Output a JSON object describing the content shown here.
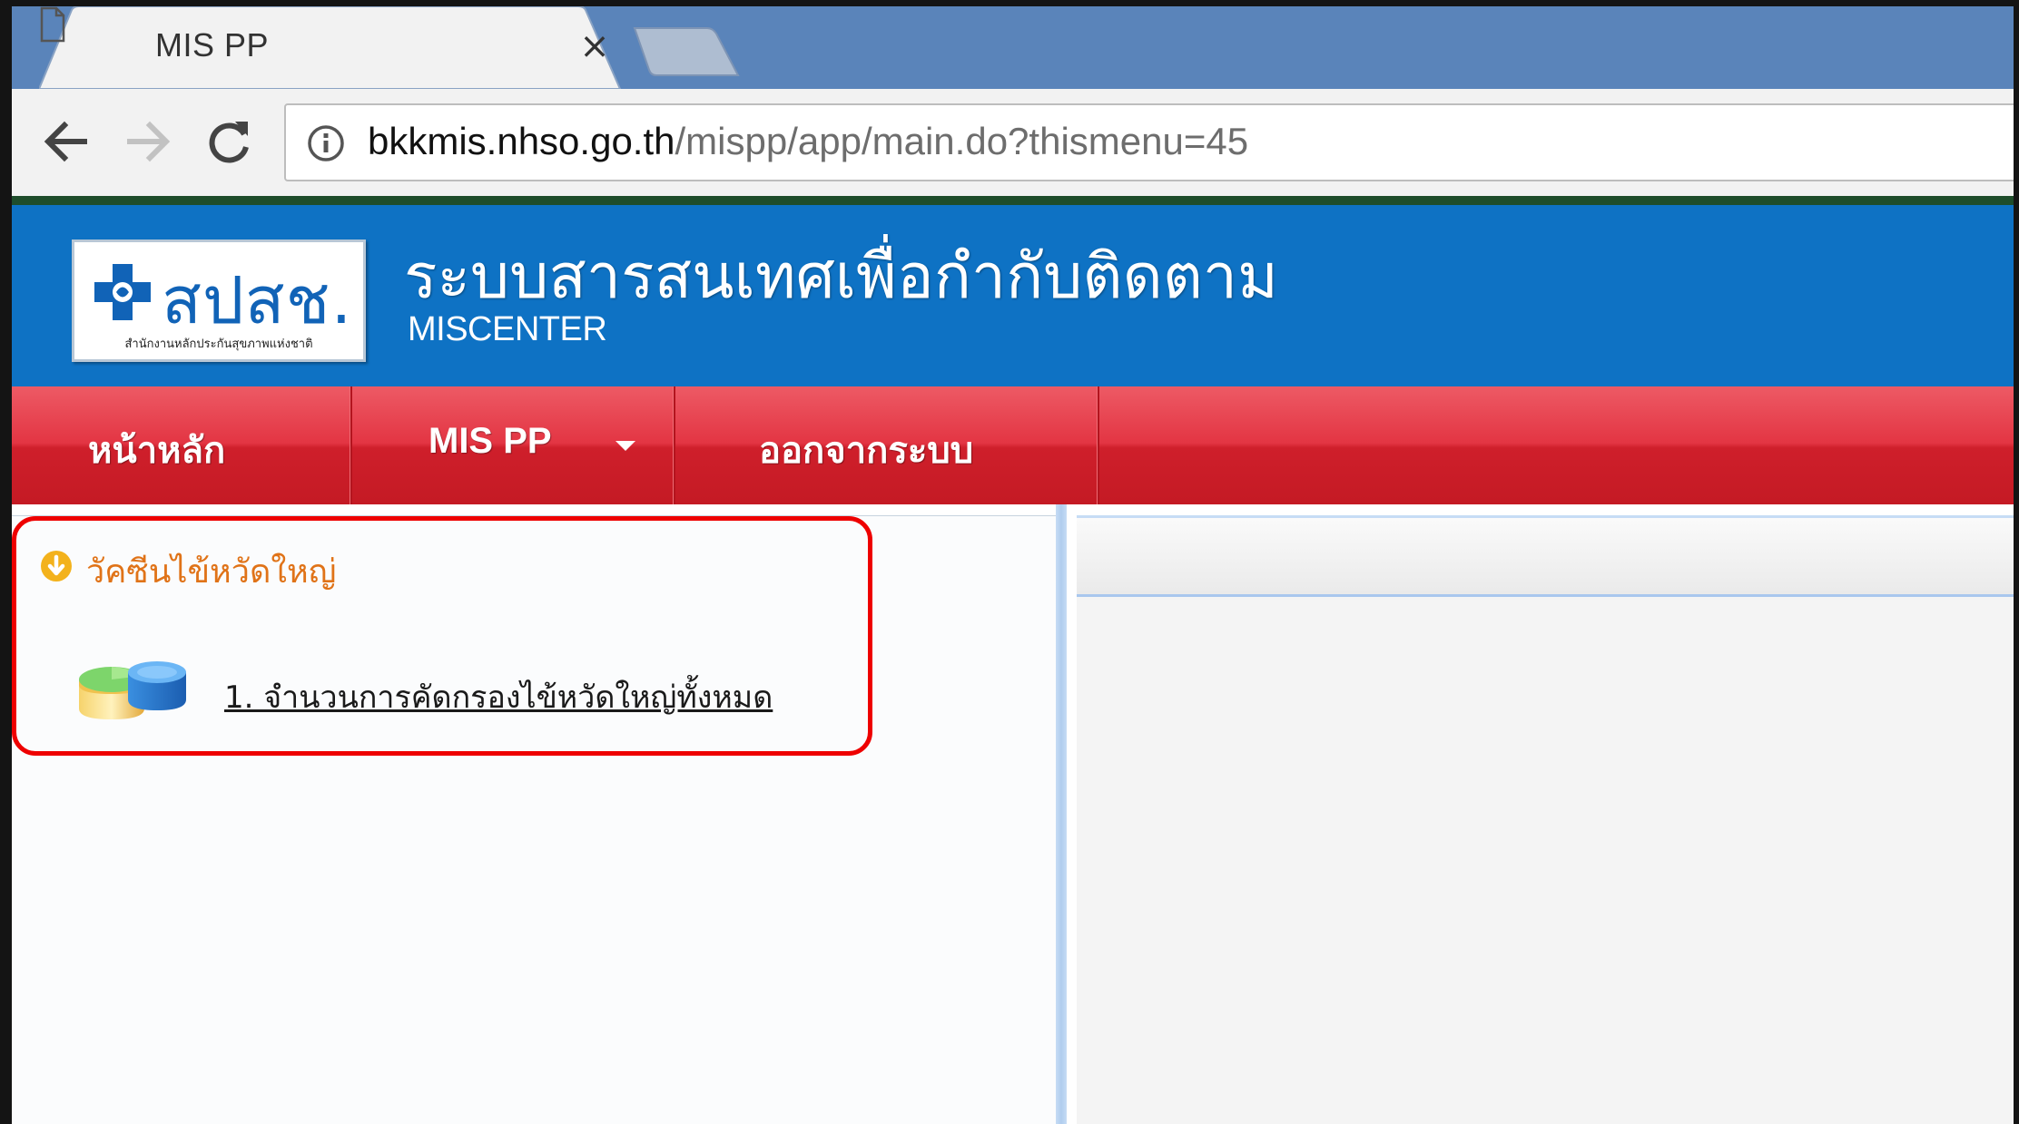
{
  "browser": {
    "tab_title": "MIS PP",
    "tab_close": "×",
    "url_host": "bkkmis.nhso.go.th",
    "url_path": "/mispp/app/main.do?thismenu=45",
    "icons": {
      "back": "arrow-left-icon",
      "forward": "arrow-right-icon",
      "reload": "reload-icon",
      "info": "info-icon",
      "page": "document-icon"
    }
  },
  "header": {
    "logo_text": "สปสช.",
    "logo_subtext": "สำนักงานหลักประกันสุขภาพแห่งชาติ",
    "title": "ระบบสารสนเทศเพื่อกำกับติดตาม",
    "subtitle": "MISCENTER",
    "brand_color": "#0e72c4"
  },
  "nav": {
    "items": [
      {
        "label": "หน้าหลัก"
      },
      {
        "label": "MIS PP",
        "has_dropdown": true
      },
      {
        "label": "ออกจากระบบ"
      }
    ],
    "color": "#e33543"
  },
  "sidebar": {
    "section_title": "วัคซีนไข้หวัดใหญ่",
    "section_icon": "arrow-down-circle-icon",
    "items": [
      {
        "label": "1. จำนวนการคัดกรองไข้หวัดใหญ่ทั้งหมด",
        "icon": "database-icon"
      }
    ],
    "section_color": "#e07318",
    "highlight_color": "#ee0000"
  }
}
